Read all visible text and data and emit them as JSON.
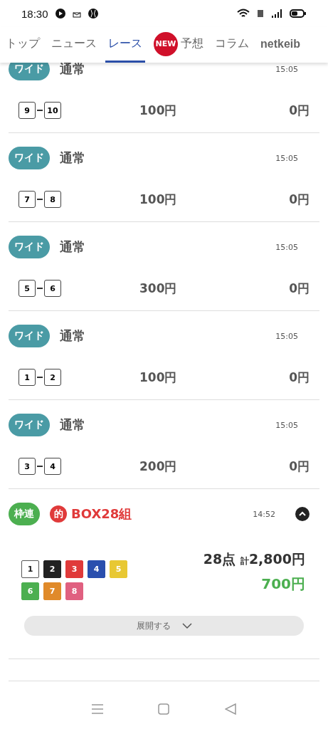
{
  "status_bar": {
    "time": "18:30"
  },
  "tabs": [
    {
      "label": "トップ",
      "selected": false
    },
    {
      "label": "ニュース",
      "selected": false
    },
    {
      "label": "レース",
      "selected": true
    },
    {
      "label": "予想",
      "selected": false,
      "badge": "NEW"
    },
    {
      "label": "コラム",
      "selected": false
    },
    {
      "label": "netkeib",
      "selected": false
    }
  ],
  "bets": [
    {
      "kind": "pair",
      "type": "ワイド",
      "color": "#4a9ba5",
      "name": "通常",
      "time": "15:05",
      "numbers": [
        "9",
        "10"
      ],
      "amount": "100円",
      "payout": "0円",
      "clipped": true
    },
    {
      "kind": "pair",
      "type": "ワイド",
      "color": "#4a9ba5",
      "name": "通常",
      "time": "15:05",
      "numbers": [
        "7",
        "8"
      ],
      "amount": "100円",
      "payout": "0円"
    },
    {
      "kind": "pair",
      "type": "ワイド",
      "color": "#4a9ba5",
      "name": "通常",
      "time": "15:05",
      "numbers": [
        "5",
        "6"
      ],
      "amount": "300円",
      "payout": "0円"
    },
    {
      "kind": "pair",
      "type": "ワイド",
      "color": "#4a9ba5",
      "name": "通常",
      "time": "15:05",
      "numbers": [
        "1",
        "2"
      ],
      "amount": "100円",
      "payout": "0円"
    },
    {
      "kind": "pair",
      "type": "ワイド",
      "color": "#4a9ba5",
      "name": "通常",
      "time": "15:05",
      "numbers": [
        "3",
        "4"
      ],
      "amount": "200円",
      "payout": "0円"
    },
    {
      "kind": "box",
      "type": "枠連",
      "color": "#4caf50",
      "mark": "的",
      "name": "BOX28組",
      "time": "14:52",
      "expanded": true,
      "frames": [
        {
          "label": "1",
          "color": "#ffffff"
        },
        {
          "label": "2",
          "color": "#222222"
        },
        {
          "label": "3",
          "color": "#e03a3a"
        },
        {
          "label": "4",
          "color": "#2a4fae"
        },
        {
          "label": "5",
          "color": "#e8c833"
        },
        {
          "label": "6",
          "color": "#4caf50"
        },
        {
          "label": "7",
          "color": "#e08a2a"
        },
        {
          "label": "8",
          "color": "#e06080"
        }
      ],
      "points": "28点",
      "total_label": "計",
      "total": "2,800円",
      "payout": "700円",
      "expand_label": "展開する"
    }
  ]
}
